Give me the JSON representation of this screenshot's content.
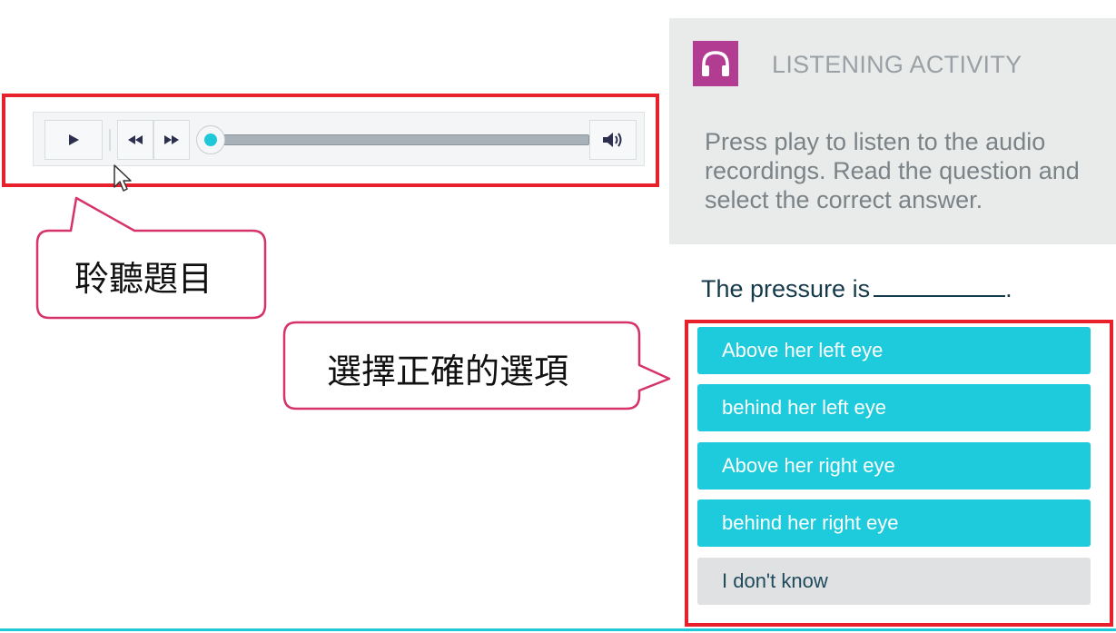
{
  "player": {
    "progress_fraction": 0.0,
    "controls": {
      "play_icon": "play-icon",
      "rewind_icon": "rewind-icon",
      "fast_forward_icon": "fast-forward-icon",
      "volume_icon": "volume-icon"
    }
  },
  "callouts": {
    "listen": "聆聽題目",
    "select": "選擇正確的選項"
  },
  "activity": {
    "title": "LISTENING ACTIVITY",
    "icon": "headphones-icon",
    "instructions": "Press play to  listen to the audio recordings. Read the question and select the correct answer."
  },
  "question": {
    "text": "The pressure is",
    "trailing": "."
  },
  "options": [
    "Above her left eye",
    "behind her left eye",
    "Above her right eye",
    "behind her right eye",
    "I don't know"
  ],
  "colors": {
    "highlight_red": "#e8202c",
    "option_teal": "#1ecbdc",
    "icon_magenta": "#b23c92",
    "callout_border": "#d6336c",
    "panel_grey": "#e9ebeb"
  }
}
